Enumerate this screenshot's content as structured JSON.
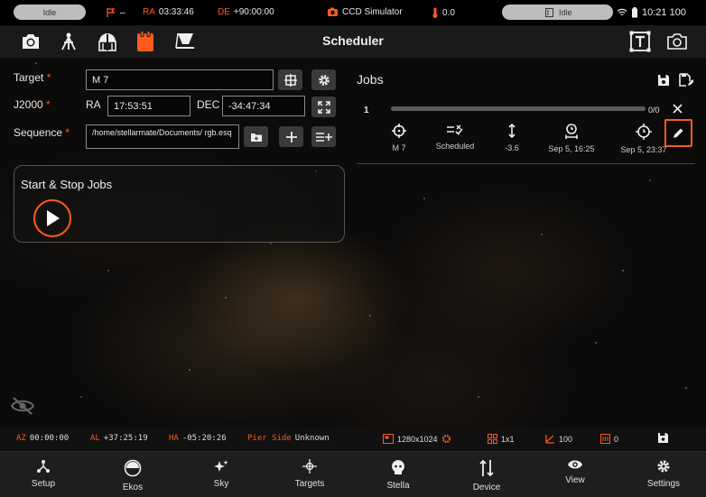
{
  "status": {
    "left_pill": "Idle",
    "ra_label": "RA",
    "ra_value": "03:33:46",
    "de_label": "DE",
    "de_value": "+90:00:00",
    "mount_dash": "–",
    "camera_name": "CCD Simulator",
    "temp_value": "0.0",
    "right_pill": "Idle",
    "clock": "10:21 100"
  },
  "toolbar": {
    "title": "Scheduler"
  },
  "form": {
    "target_label": "Target",
    "target_value": "M 7",
    "j2000_label": "J2000",
    "ra_label": "RA",
    "ra_value": "17:53:51",
    "dec_label": "DEC",
    "dec_value": "-34:47:34",
    "sequence_label": "Sequence",
    "sequence_path": "/home/stellarmate/Documents/ rgb.esq",
    "required_mark": "*"
  },
  "startstop": {
    "title": "Start & Stop Jobs"
  },
  "jobs": {
    "title": "Jobs",
    "row_index": "1",
    "progress_text": "0/0",
    "progress_fraction": 0,
    "cells": [
      {
        "icon": "crosshair-icon",
        "label": "M 7"
      },
      {
        "icon": "status-list-icon",
        "label": "Scheduled"
      },
      {
        "icon": "altitude-arrow-icon",
        "label": "-3.6"
      },
      {
        "icon": "start-time-icon",
        "label": "Sep 5, 16:25"
      },
      {
        "icon": "end-time-icon",
        "label": "Sep 5, 23:37"
      }
    ]
  },
  "infobar": {
    "az_label": "AZ",
    "az_value": "00:00:00",
    "al_label": "AL",
    "al_value": "+37:25:19",
    "ha_label": "HA",
    "ha_value": "-05:20:26",
    "pier_label": "Pier Side",
    "pier_value": "Unknown",
    "resolution": "1280x1024",
    "binning": "1x1",
    "gain": "100",
    "offset": "0"
  },
  "nav": [
    {
      "label": "Setup",
      "icon": "setup-icon"
    },
    {
      "label": "Ekos",
      "icon": "ekos-icon"
    },
    {
      "label": "Sky",
      "icon": "sky-icon"
    },
    {
      "label": "Targets",
      "icon": "targets-icon"
    },
    {
      "label": "Stella",
      "icon": "stella-icon"
    },
    {
      "label": "Device",
      "icon": "device-icon"
    },
    {
      "label": "View",
      "icon": "view-icon"
    },
    {
      "label": "Settings",
      "icon": "settings-icon"
    }
  ],
  "colors": {
    "accent": "#ff5a1f",
    "background": "#0c0b0a",
    "nav": "#1e1e1e"
  }
}
